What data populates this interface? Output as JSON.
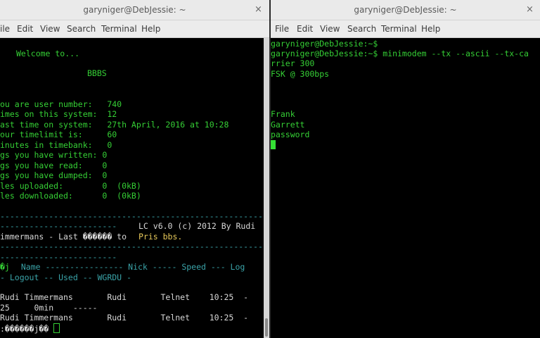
{
  "left_window": {
    "title": "garyniger@DebJessie: ~",
    "close_symbol": "×",
    "menu": [
      "ile",
      "Edit",
      "View",
      "Search",
      "Terminal",
      "Help"
    ],
    "lines": {
      "welcome": "Welcome to...",
      "bbbs": "BBBS",
      "l1": "ou are user number:   740",
      "l2": "imes on this system:  12",
      "l3": "ast time on system:   27th April, 2016 at 10:28",
      "l4": "our timelimit is:     60",
      "l5": "inutes in timebank:   0",
      "l6": "gs you have written: 0",
      "l7": "gs you have read:    0",
      "l8": "gs you have dumped:  0",
      "l9": "les uploaded:        0  (0kB)",
      "l10": "les downloaded:      0  (0kB)",
      "sep1": "-------------------------------------------------------",
      "sep2a": "------------------------",
      "sep2b": "LC v6.0 (c) 2012 By Rudi",
      "l11a": "immermans - Last ������ to ",
      "l11b": "Pris bbs.",
      "sep3": "-------------------------------------------------------",
      "sep4": "------------------------",
      "hdr1_glyph": "�j",
      "hdr1_rest": "  Name ---------------- Nick ----- Speed --- Log",
      "hdr2": "- Logout -- Used -- WGRDU -",
      "row1": "Rudi Timmermans       Rudi       Telnet    10:25  -",
      "row1b": "25     0min    -----",
      "row2": "Rudi Timmermans       Rudi       Telnet    10:25  -",
      "prompt": ":������j��"
    }
  },
  "right_window": {
    "title": "garyniger@DebJessie: ~",
    "close_symbol": "×",
    "menu": [
      "File",
      "Edit",
      "View",
      "Search",
      "Terminal",
      "Help"
    ],
    "lines": {
      "p1": "garyniger@DebJessie:~$",
      "p2": "garyniger@DebJessie:~$ minimodem --tx --ascii --tx-ca",
      "p3": "rrier 300",
      "p4": "FSK @ 300bps",
      "o1": "Frank",
      "o2": "Garrett",
      "o3": "password"
    }
  }
}
